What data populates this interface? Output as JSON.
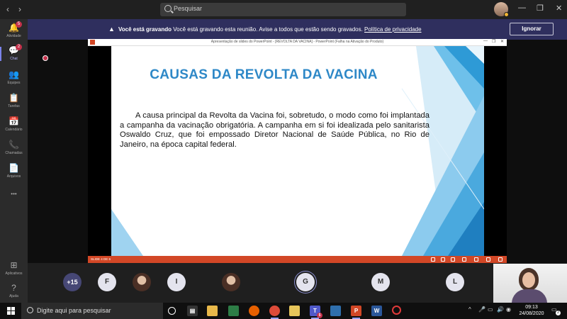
{
  "titlebar": {
    "back": "‹",
    "forward": "›",
    "search_placeholder": "Pesquisar",
    "minimize": "—",
    "maximize": "❐",
    "close": "✕"
  },
  "rail": {
    "items": [
      {
        "label": "Atividade",
        "icon": "bell-icon",
        "glyph": "🔔",
        "badge": "5"
      },
      {
        "label": "Chat",
        "icon": "chat-icon",
        "glyph": "💬",
        "badge": "2"
      },
      {
        "label": "Equipes",
        "icon": "teams-icon",
        "glyph": "👥"
      },
      {
        "label": "Tarefas",
        "icon": "tasks-icon",
        "glyph": "📋"
      },
      {
        "label": "Calendário",
        "icon": "calendar-icon",
        "glyph": "📅"
      },
      {
        "label": "Chamadas",
        "icon": "phone-icon",
        "glyph": "📞"
      },
      {
        "label": "Arquivos",
        "icon": "files-icon",
        "glyph": "📄"
      },
      {
        "label": "",
        "icon": "more-icon",
        "glyph": "•••"
      },
      {
        "label": "Aplicativos",
        "icon": "apps-icon",
        "glyph": "⊞"
      },
      {
        "label": "Ajuda",
        "icon": "help-icon",
        "glyph": "?"
      }
    ]
  },
  "banner": {
    "bold": "Você está gravando",
    "text": " Você está gravando esta reunião. Avise a todos que estão sendo gravados. ",
    "link": "Política de privacidade",
    "ignore": "Ignorar"
  },
  "ppt": {
    "window_title": "Apresentação de slides do PowerPoint - [REVOLTA DA VACINA] - PowerPoint (Falha na Ativação do Produto)",
    "slide_title": "CAUSAS DA REVOLTA DA VACINA",
    "slide_body": "A causa principal da Revolta da Vacina foi, sobretudo, o modo como foi implantada a campanha da vacinação obrigatória. A campanha em si foi idealizada pelo sanitarista Oswaldo Cruz, que foi empossado Diretor Nacional de Saúde Pública, no Rio de Janeiro, na época capital federal.",
    "status": "SLIDE 4 DE 6",
    "accent_color": "#2e88c7",
    "brand_color": "#d24726"
  },
  "participants": [
    {
      "kind": "more",
      "label": "+15"
    },
    {
      "kind": "letter",
      "label": "F"
    },
    {
      "kind": "photo",
      "label": ""
    },
    {
      "kind": "letter",
      "label": "I"
    },
    {
      "kind": "photo",
      "label": ""
    },
    {
      "kind": "letter",
      "label": "G"
    },
    {
      "kind": "letter",
      "label": "M"
    },
    {
      "kind": "letter",
      "label": "L"
    }
  ],
  "taskbar": {
    "search_placeholder": "Digite aqui para pesquisar",
    "time": "09:13",
    "date": "24/08/2020",
    "notification_count": "2",
    "teams_badge": "5"
  }
}
